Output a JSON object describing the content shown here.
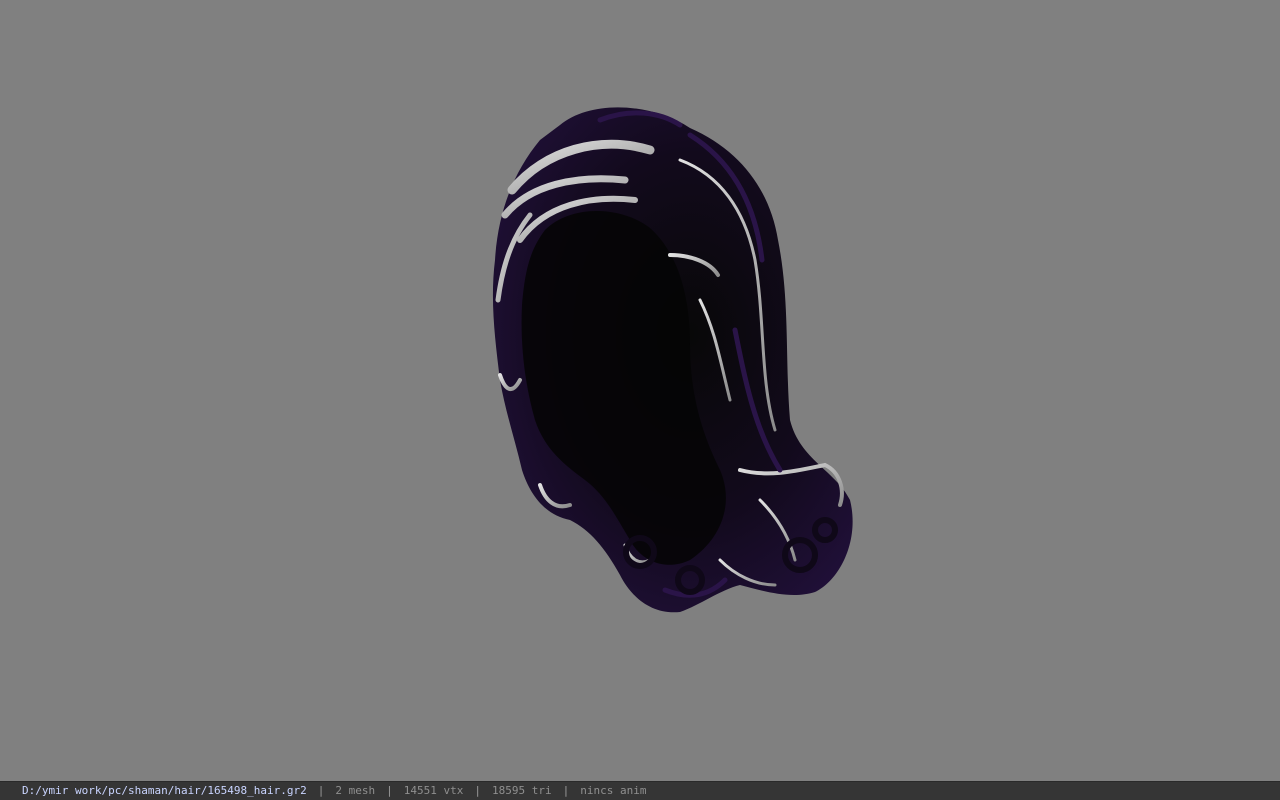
{
  "viewport": {
    "background": "#808080",
    "model_name": "165498_hair",
    "model_colors": {
      "hair_dark": "#1f0f33",
      "hair_shadow": "#0a0a0c",
      "highlight": "#c9c9c9"
    }
  },
  "status_bar": {
    "file_path": "D:/ymir work/pc/shaman/hair/165498_hair.gr2",
    "separator": "|",
    "mesh_count": "2 mesh",
    "vertex_count": "14551 vtx",
    "triangle_count": "18595 tri",
    "anim_status": "nincs anim"
  }
}
